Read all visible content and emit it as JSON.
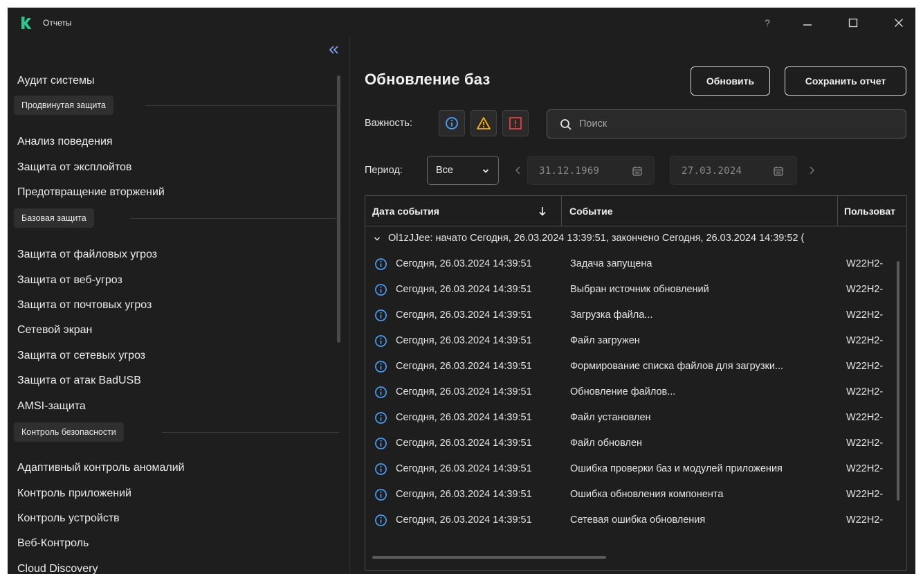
{
  "window": {
    "title": "Отчеты",
    "help": "?"
  },
  "sidebar": {
    "top_item": "Аудит системы",
    "groups": [
      {
        "label": "Продвинутая защита",
        "items": [
          "Анализ поведения",
          "Защита от эксплойтов",
          "Предотвращение вторжений"
        ]
      },
      {
        "label": "Базовая защита",
        "items": [
          "Защита от файловых угроз",
          "Защита от веб-угроз",
          "Защита от почтовых угроз",
          "Сетевой экран",
          "Защита от сетевых угроз",
          "Защита от атак BadUSB",
          "AMSI-защита"
        ]
      },
      {
        "label": "Контроль безопасности",
        "items": [
          "Адаптивный контроль аномалий",
          "Контроль приложений",
          "Контроль устройств",
          "Веб-Контроль",
          "Cloud Discovery"
        ]
      }
    ]
  },
  "main": {
    "title": "Обновление баз",
    "refresh_label": "Обновить",
    "save_label": "Сохранить отчет",
    "severity_label": "Важность:",
    "search_placeholder": "Поиск",
    "period_label": "Период:",
    "period_value": "Все",
    "date_from": "31.12.1969",
    "date_to": "27.03.2024"
  },
  "table": {
    "columns": [
      "Дата события",
      "Событие",
      "Пользоват"
    ],
    "sort": "descending",
    "group_header": "Ol1zJJee: начато Сегодня, 26.03.2024 13:39:51, закончено Сегодня, 26.03.2024 14:39:52 (",
    "rows": [
      {
        "date": "Сегодня, 26.03.2024 14:39:51",
        "event": "Задача запущена",
        "user": "W22H2-"
      },
      {
        "date": "Сегодня, 26.03.2024 14:39:51",
        "event": "Выбран источник обновлений",
        "user": "W22H2-"
      },
      {
        "date": "Сегодня, 26.03.2024 14:39:51",
        "event": "Загрузка файла...",
        "user": "W22H2-"
      },
      {
        "date": "Сегодня, 26.03.2024 14:39:51",
        "event": "Файл загружен",
        "user": "W22H2-"
      },
      {
        "date": "Сегодня, 26.03.2024 14:39:51",
        "event": "Формирование списка файлов для загрузки...",
        "user": "W22H2-"
      },
      {
        "date": "Сегодня, 26.03.2024 14:39:51",
        "event": "Обновление файлов...",
        "user": "W22H2-"
      },
      {
        "date": "Сегодня, 26.03.2024 14:39:51",
        "event": "Файл установлен",
        "user": "W22H2-"
      },
      {
        "date": "Сегодня, 26.03.2024 14:39:51",
        "event": "Файл обновлен",
        "user": "W22H2-"
      },
      {
        "date": "Сегодня, 26.03.2024 14:39:51",
        "event": "Ошибка проверки баз и модулей приложения",
        "user": "W22H2-"
      },
      {
        "date": "Сегодня, 26.03.2024 14:39:51",
        "event": "Ошибка обновления компонента",
        "user": "W22H2-"
      },
      {
        "date": "Сегодня, 26.03.2024 14:39:51",
        "event": "Сетевая ошибка обновления",
        "user": "W22H2-"
      }
    ]
  },
  "icons": {
    "severity": [
      "info-icon",
      "warning-icon",
      "error-icon"
    ],
    "row": "info-icon"
  },
  "colors": {
    "background": "#1e1e1e",
    "logo": "#29c98b",
    "info": "#4aa3ff",
    "warning": "#f5b400",
    "error": "#e8403f"
  }
}
